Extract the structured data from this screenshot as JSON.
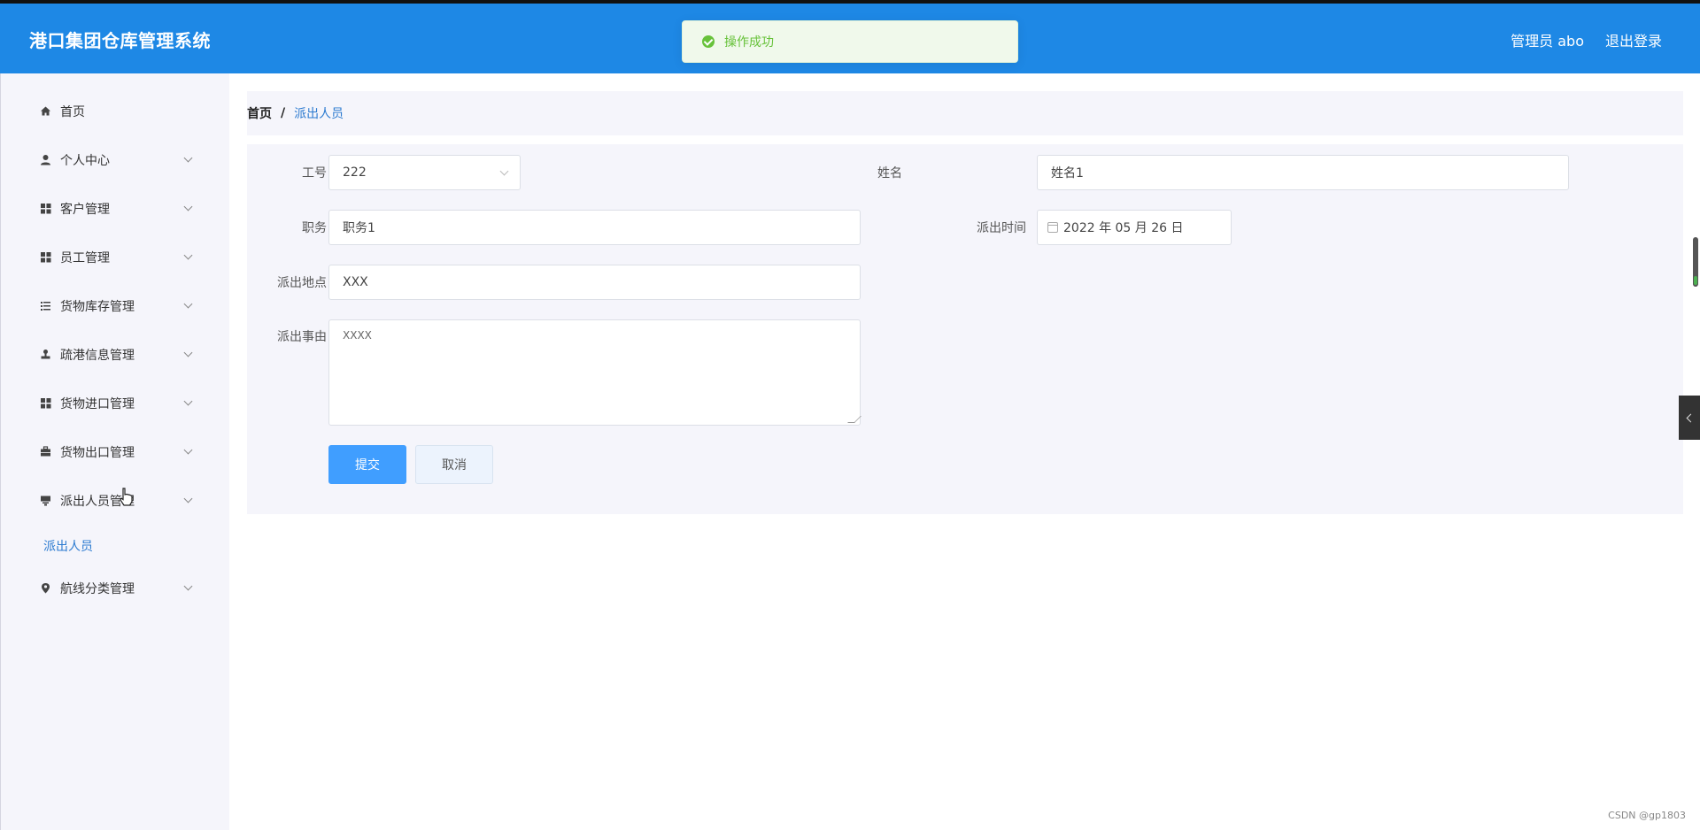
{
  "header": {
    "app_title": "港口集团仓库管理系统",
    "user_label": "管理员 abo",
    "logout_label": "退出登录"
  },
  "toast": {
    "message": "操作成功",
    "status_color": "#67c23a"
  },
  "sidebar": {
    "items": [
      {
        "label": "首页",
        "icon": "home-icon",
        "expandable": false
      },
      {
        "label": "个人中心",
        "icon": "user-icon",
        "expandable": true
      },
      {
        "label": "客户管理",
        "icon": "grid-icon",
        "expandable": true
      },
      {
        "label": "员工管理",
        "icon": "grid-icon",
        "expandable": true
      },
      {
        "label": "货物库存管理",
        "icon": "list-icon",
        "expandable": true
      },
      {
        "label": "疏港信息管理",
        "icon": "stamp-icon",
        "expandable": true
      },
      {
        "label": "货物进口管理",
        "icon": "grid-icon",
        "expandable": true
      },
      {
        "label": "货物出口管理",
        "icon": "briefcase-icon",
        "expandable": true
      },
      {
        "label": "派出人员管理",
        "icon": "tray-icon",
        "expandable": true
      },
      {
        "label": "航线分类管理",
        "icon": "pin-icon",
        "expandable": true
      }
    ],
    "active_subitem": "派出人员"
  },
  "breadcrumb": {
    "home": "首页",
    "separator": "/",
    "current": "派出人员"
  },
  "form": {
    "employee_no_label": "工号",
    "employee_no_value": "222",
    "name_label": "姓名",
    "name_value": "姓名1",
    "position_label": "职务",
    "position_value": "职务1",
    "dispatch_time_label": "派出时间",
    "dispatch_time_value": "2022 年 05 月 26 日",
    "location_label": "派出地点",
    "location_value": "XXX",
    "reason_label": "派出事由",
    "reason_value": "XXXX",
    "submit_label": "提交",
    "cancel_label": "取消"
  },
  "watermark": "CSDN @gp1803",
  "colors": {
    "header_bg": "#1e88e5",
    "accent": "#409eff",
    "sidebar_bg": "#f5f5fb",
    "active_link": "#2d7bd0"
  }
}
